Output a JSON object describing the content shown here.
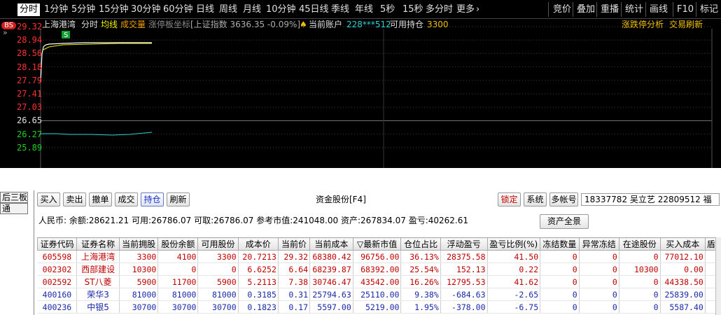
{
  "toolbar": {
    "tabs": [
      "分时",
      "1分钟",
      "5分钟",
      "15分钟",
      "30分钟",
      "60分钟",
      "日线",
      "周线",
      "月线",
      "10分钟",
      "45日线",
      "季线",
      "年线",
      "5秒",
      "15秒",
      "多分时",
      "更多"
    ],
    "right_buttons": [
      "竞价",
      "叠加",
      "重播",
      "统计",
      "画线",
      "F10",
      "标记"
    ]
  },
  "chart": {
    "stock_name": "上海港湾",
    "mode": "分时",
    "avg_label": "均线",
    "vol_label": "成交量",
    "limit_label": "涨停板坐标",
    "index_label": "[上证指数 3636.35 -0.09%]",
    "account_label": "当前账户",
    "account_value": "228***512",
    "available_label": "可用持仓",
    "available_value": "3300",
    "analysis_label": "涨跌停分析",
    "trade_refresh_label": "交易刷新",
    "bs_badge": "BS",
    "s_marker": "S",
    "price_ticks": [
      "29.32",
      "28.94",
      "28.56",
      "28.18",
      "27.79",
      "27.41",
      "27.03",
      "26.65",
      "26.27",
      "25.89"
    ],
    "price_colors": [
      "#ff3030",
      "#ff3030",
      "#ff3030",
      "#ff3030",
      "#ff3030",
      "#ff3030",
      "#ff3030",
      "#e0e0e0",
      "#20d020",
      "#20d020"
    ],
    "colors": {
      "price_line": "#ffffff",
      "avg_line": "#f0f000",
      "ref_line": "#30d0d0",
      "grid": "#3a3a3a"
    }
  },
  "stub": {
    "top": "后三板",
    "bottom": "通"
  },
  "panel": {
    "buttons": [
      "买入",
      "卖出",
      "撤单",
      "成交",
      "持仓",
      "刷新"
    ],
    "active_button": "持仓",
    "title": "资金股份[F4]",
    "lock_button": "锁定",
    "system_button": "系统",
    "multi_button": "多帐号",
    "account_info": "18337782  吴立艺 22809512 福",
    "summary": "人民币: 余额:28621.21  可用:26786.07  可取:26786.07  参考市值:241048.00  资产:267834.07  盈亏:40262.61",
    "asset_button": "资产全景"
  },
  "table": {
    "headers": [
      "证券代码",
      "证券名称",
      "当前拥股",
      "股份余额",
      "可用股份",
      "成本价",
      "当前价",
      "当前成本",
      "▽最新市值",
      "仓位占比",
      "浮动盈亏",
      "盈亏比例(%)",
      "冻结数量",
      "异常冻结",
      "在途股份",
      "买入成本",
      "盾"
    ],
    "rows": [
      {
        "dir": "up",
        "cells": [
          "605598",
          "上海港湾",
          "3300",
          "4100",
          "3300",
          "20.7213",
          "29.32",
          "68380.42",
          "96756.00",
          "36.13%",
          "28375.58",
          "41.50",
          "0",
          "0",
          "0",
          "77012.10",
          ""
        ]
      },
      {
        "dir": "up",
        "cells": [
          "002302",
          "西部建设",
          "10300",
          "0",
          "0",
          "6.6252",
          "6.64",
          "68239.87",
          "68392.00",
          "25.54%",
          "152.13",
          "0.22",
          "0",
          "0",
          "10300",
          "0.00",
          ""
        ]
      },
      {
        "dir": "up",
        "cells": [
          "002592",
          "ST八菱",
          "5900",
          "11700",
          "5900",
          "5.2113",
          "7.38",
          "30746.47",
          "43542.00",
          "16.26%",
          "12795.53",
          "41.62",
          "0",
          "0",
          "0",
          "44338.50",
          ""
        ]
      },
      {
        "dir": "down",
        "cells": [
          "400160",
          "荣华3",
          "81000",
          "81000",
          "81000",
          "0.3185",
          "0.31",
          "25794.63",
          "25110.00",
          "9.38%",
          "-684.63",
          "-2.65",
          "0",
          "0",
          "0",
          "25839.00",
          ""
        ]
      },
      {
        "dir": "down",
        "cells": [
          "400236",
          "中银5",
          "30700",
          "30700",
          "30700",
          "0.1823",
          "0.17",
          "5597.00",
          "5219.00",
          "1.95%",
          "-378.00",
          "-6.75",
          "0",
          "0",
          "0",
          "5587.40",
          ""
        ]
      }
    ]
  }
}
